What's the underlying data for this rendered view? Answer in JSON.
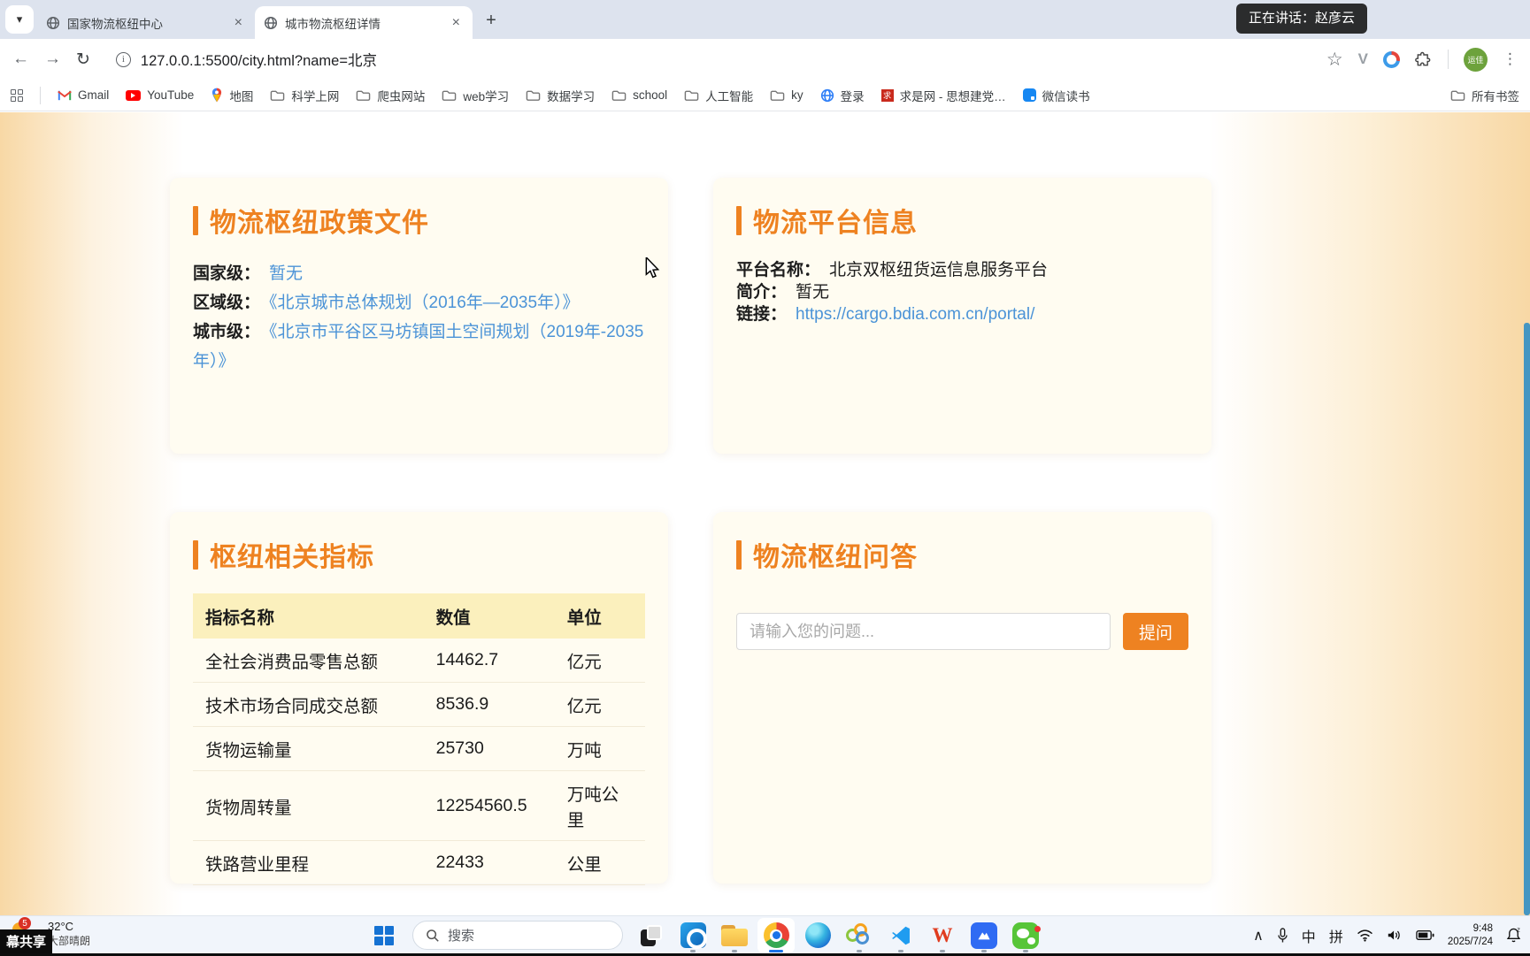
{
  "overlays": {
    "speaking": "正在讲话：赵彦云",
    "screen_share": "幕共享"
  },
  "browser": {
    "tabs": [
      {
        "title": "国家物流枢纽中心"
      },
      {
        "title": "城市物流枢纽详情"
      }
    ],
    "url": "127.0.0.1:5500/city.html?name=北京",
    "avatar_label": "运佳",
    "bookmarks": [
      {
        "label": "Gmail"
      },
      {
        "label": "YouTube"
      },
      {
        "label": "地图"
      },
      {
        "label": "科学上网"
      },
      {
        "label": "爬虫网站"
      },
      {
        "label": "web学习"
      },
      {
        "label": "数据学习"
      },
      {
        "label": "school"
      },
      {
        "label": "人工智能"
      },
      {
        "label": "ky"
      },
      {
        "label": "登录"
      },
      {
        "label": "求是网 - 思想建党…"
      },
      {
        "label": "微信读书"
      }
    ],
    "all_bookmarks_label": "所有书签"
  },
  "page": {
    "cards": {
      "policy": {
        "title": "物流枢纽政策文件",
        "rows": [
          {
            "label": "国家级：",
            "value": "暂无"
          },
          {
            "label": "区域级：",
            "value": "《北京城市总体规划（2016年—2035年）》"
          },
          {
            "label": "城市级：",
            "value": "《北京市平谷区马坊镇国土空间规划（2019年-2035年）》"
          }
        ]
      },
      "platform": {
        "title": "物流平台信息",
        "rows": [
          {
            "label": "平台名称：",
            "value": "北京双枢纽货运信息服务平台"
          },
          {
            "label": "简介：",
            "value": "暂无"
          },
          {
            "label": "链接：",
            "value": "https://cargo.bdia.com.cn/portal/"
          }
        ]
      },
      "indicators": {
        "title": "枢纽相关指标",
        "table": {
          "headers": [
            "指标名称",
            "数值",
            "单位"
          ],
          "rows": [
            [
              "全社会消费品零售总额",
              "14462.7",
              "亿元"
            ],
            [
              "技术市场合同成交总额",
              "8536.9",
              "亿元"
            ],
            [
              "货物运输量",
              "25730",
              "万吨"
            ],
            [
              "货物周转量",
              "12254560.5",
              "万吨公里"
            ],
            [
              "铁路营业里程",
              "22433",
              "公里"
            ]
          ]
        }
      },
      "qa": {
        "title": "物流枢纽问答",
        "input_placeholder": "请输入您的问题...",
        "button_label": "提问"
      }
    }
  },
  "taskbar": {
    "weather": {
      "badge": "5",
      "temp": "32°C",
      "desc": "大部晴朗"
    },
    "search_label": "搜索",
    "tray": {
      "ime": "中",
      "pinyin": "拼",
      "time": "9:48",
      "date": "2025/7/24"
    }
  },
  "icons": {
    "chevron_down": "▾",
    "close": "×",
    "new_tab": "+",
    "back": "←",
    "forward": "→",
    "reload": "↻",
    "star": "☆",
    "kebab": "⋮",
    "extension_v": "V",
    "info": "i",
    "qiushi": "求",
    "wps": "W",
    "chevron_up": "∧"
  },
  "colors": {
    "accent": "#ee8221",
    "link": "#4b93d7",
    "table_header_bg": "#fbf0bd"
  }
}
